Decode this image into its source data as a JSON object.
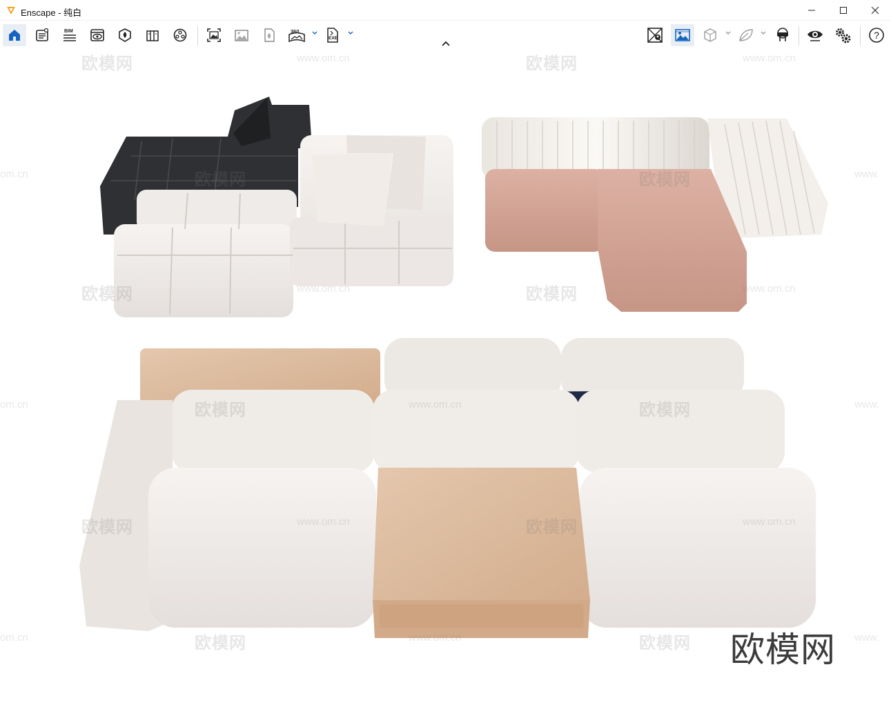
{
  "window": {
    "app_name": "Enscape",
    "separator": " - ",
    "project_name": "纯白",
    "accent_color": "#f2a31b"
  },
  "toolbar": {
    "left_icons": [
      "home-icon",
      "project-info-icon",
      "bim-icon",
      "view-settings-icon",
      "materials-icon",
      "library-icon",
      "asset-library-icon"
    ],
    "bim_label": "BIM",
    "capture_icons": [
      "screenshot-icon",
      "batch-render-icon",
      "export-file-icon",
      "panorama-360-icon",
      "exe-export-icon"
    ],
    "panorama_label": "360",
    "exe_label": "EXE",
    "right_icons": [
      "map-icon",
      "visual-settings-icon",
      "cube-icon",
      "leaf-icon",
      "vr-headset-icon",
      "eye-icon",
      "settings-gears-icon",
      "help-icon"
    ],
    "help_label": "?"
  },
  "watermarks": {
    "site_text": "欧模网",
    "url_text": "www.om.cn",
    "url_short": "om.cn",
    "url_cut": "www."
  },
  "brand_watermark": "欧模网"
}
